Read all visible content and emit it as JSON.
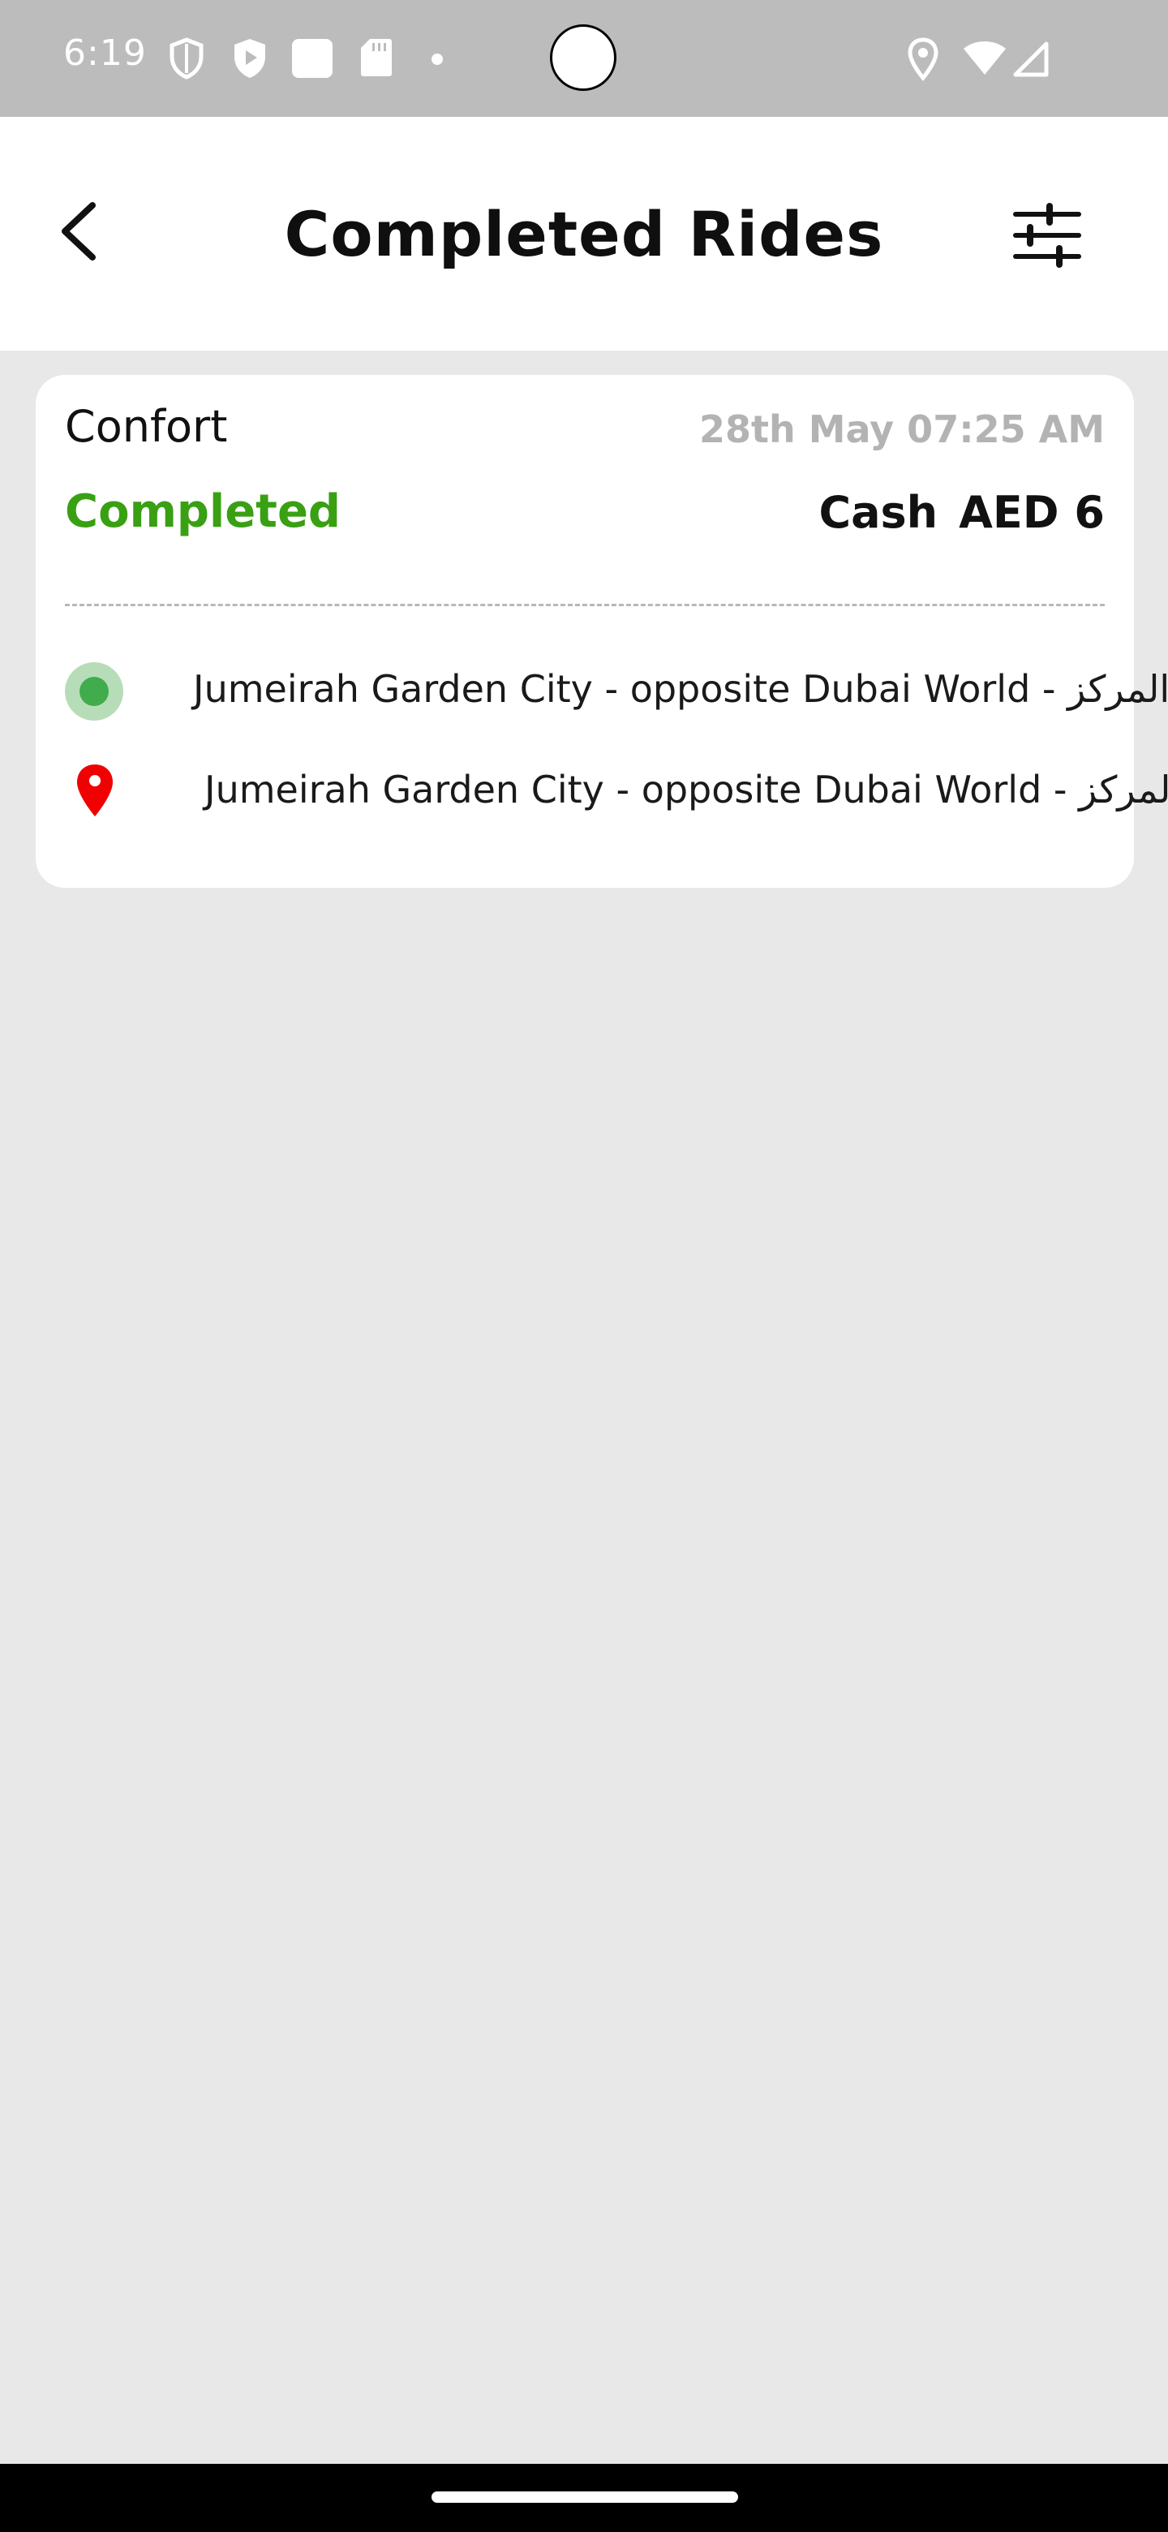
{
  "status_bar": {
    "time": "6:19",
    "icons": [
      "shield-outline-icon",
      "shield-play-icon",
      "square-icon",
      "sd-card-icon",
      "dot-icon",
      "location-icon",
      "wifi-icon",
      "signal-icon"
    ]
  },
  "header": {
    "title": "Completed Rides",
    "back_icon": "chevron-left-icon",
    "filter_icon": "sliders-icon"
  },
  "rides": [
    {
      "type": "Confort",
      "datetime": "28th May 07:25 AM",
      "status": "Completed",
      "payment_method": "Cash",
      "amount": "AED 6",
      "pickup": "Jumeirah Garden City - opposite Dubai World - المركز",
      "dropoff": "Jumeirah Garden City - opposite Dubai World - المركز"
    }
  ],
  "colors": {
    "status_completed": "#39a013",
    "pickup_marker": "#41ac4d",
    "dropoff_marker": "#f00000",
    "background": "#e9e8e9"
  }
}
